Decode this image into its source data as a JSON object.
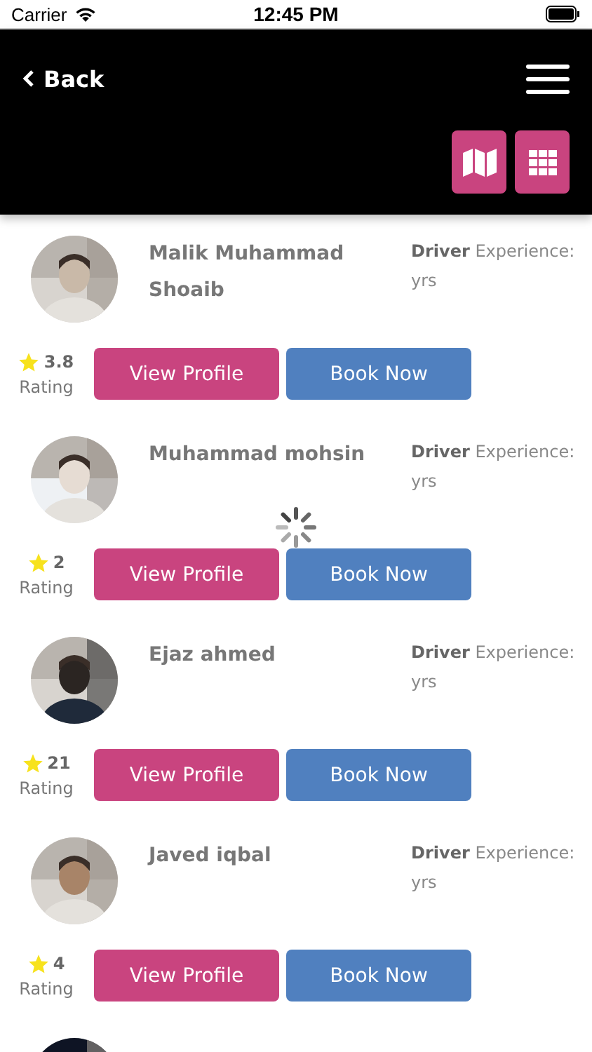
{
  "status_bar": {
    "carrier": "Carrier",
    "time": "12:45 PM"
  },
  "header": {
    "back_label": "Back"
  },
  "loading": true,
  "drivers": [
    {
      "name": "Malik Muhammad Shoaib",
      "role": "Driver",
      "experience": "Experience:",
      "unit": "yrs",
      "rating": "3.8",
      "rating_label": "Rating",
      "buttons": [
        "View Profile",
        "Book Now"
      ]
    },
    {
      "name": "Muhammad mohsin",
      "role": "Driver",
      "experience": "Experience:",
      "unit": "yrs",
      "rating": "2",
      "rating_label": "Rating",
      "buttons": [
        "View Profile",
        "Book Now"
      ]
    },
    {
      "name": "Ejaz ahmed",
      "role": "Driver",
      "experience": "Experience:",
      "unit": "yrs",
      "rating": "21",
      "rating_label": "Rating",
      "buttons": [
        "View Profile",
        "Book Now"
      ]
    },
    {
      "name": "Javed iqbal",
      "role": "Driver",
      "experience": "Experience:",
      "unit": "yrs",
      "rating": "4",
      "rating_label": "Rating",
      "buttons": [
        "View Profile",
        "Book Now"
      ]
    },
    {
      "kind": "picture"
    }
  ]
}
